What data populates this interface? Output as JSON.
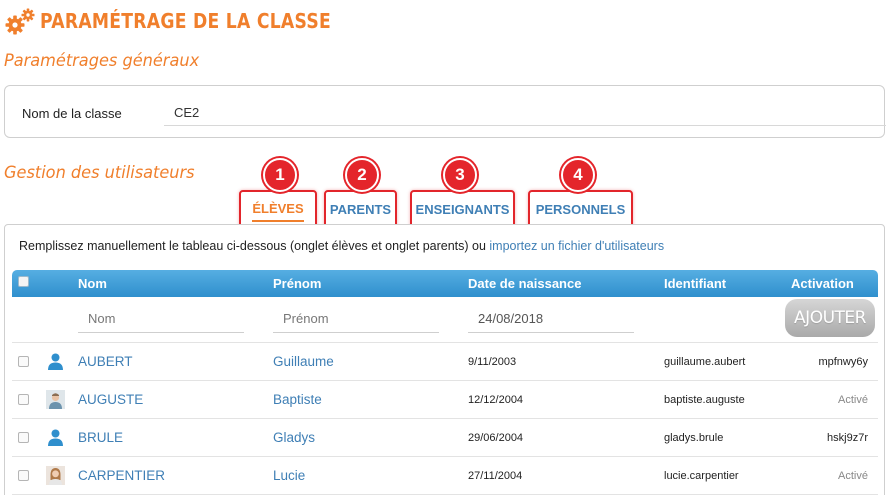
{
  "page": {
    "title": "PARAMÉTRAGE DE LA CLASSE",
    "general_title": "Paramétrages généraux",
    "users_title": "Gestion des utilisateurs"
  },
  "class_settings": {
    "name_label": "Nom de la classe",
    "name_value": "CE2"
  },
  "tabs": [
    {
      "badge": "1",
      "label": "ÉLÈVES",
      "active": true
    },
    {
      "badge": "2",
      "label": "PARENTS",
      "active": false
    },
    {
      "badge": "3",
      "label": "ENSEIGNANTS",
      "active": false
    },
    {
      "badge": "4",
      "label": "PERSONNELS",
      "active": false
    }
  ],
  "instructions": {
    "text": "Remplissez manuellement le tableau ci-dessous (onglet élèves et onglet parents) ou ",
    "link": "importez un fichier d'utilisateurs"
  },
  "table": {
    "columns": {
      "nom": "Nom",
      "prenom": "Prénom",
      "date": "Date de naissance",
      "identifiant": "Identifiant",
      "activation": "Activation"
    },
    "filters": {
      "nom_placeholder": "Nom",
      "prenom_placeholder": "Prénom",
      "date_value": "24/08/2018"
    },
    "add_button": "AJOUTER",
    "rows": [
      {
        "nom": "AUBERT",
        "prenom": "Guillaume",
        "date": "9/11/2003",
        "identifiant": "guillaume.aubert",
        "activation": "mpfnwy6y",
        "avatar": "person-icon"
      },
      {
        "nom": "AUGUSTE",
        "prenom": "Baptiste",
        "date": "12/12/2004",
        "identifiant": "baptiste.auguste",
        "activation": "Activé",
        "avatar": "photo-avatar"
      },
      {
        "nom": "BRULE",
        "prenom": "Gladys",
        "date": "29/06/2004",
        "identifiant": "gladys.brule",
        "activation": "hskj9z7r",
        "avatar": "person-icon"
      },
      {
        "nom": "CARPENTIER",
        "prenom": "Lucie",
        "date": "27/11/2004",
        "identifiant": "lucie.carpentier",
        "activation": "Activé",
        "avatar": "photo-avatar"
      }
    ]
  },
  "colors": {
    "accent_orange": "#f07f2c",
    "link_blue": "#3f7fb5",
    "header_blue": "#3a9ad6",
    "highlight_red": "#e4252b"
  }
}
